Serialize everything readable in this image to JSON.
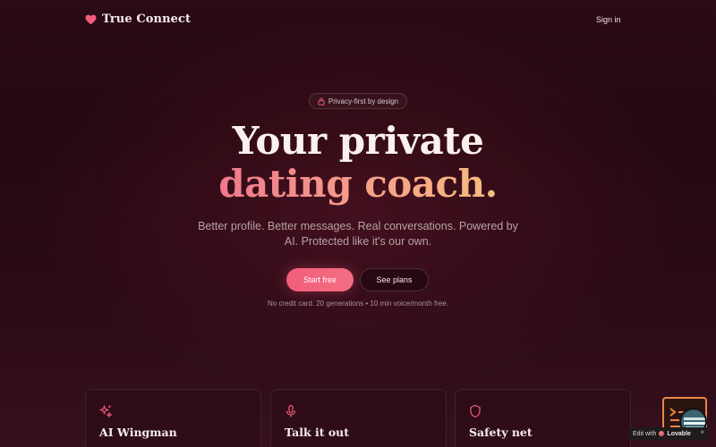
{
  "header": {
    "brand_name": "True Connect",
    "sign_in_label": "Sign in"
  },
  "hero": {
    "badge_label": "Privacy-first by design",
    "title_line1": "Your private",
    "title_line2": "dating coach.",
    "subtitle": "Better profile. Better messages. Real conversations. Powered by AI. Protected like it's our own.",
    "primary_button": "Start free",
    "secondary_button": "See plans",
    "note": "No credit card. 20 generations • 10 min voice/month free."
  },
  "features": [
    {
      "title": "AI Wingman",
      "icon": "sparkles-icon"
    },
    {
      "title": "Talk it out",
      "icon": "microphone-icon"
    },
    {
      "title": "Safety net",
      "icon": "shield-icon"
    }
  ],
  "lovable_badge": {
    "prefix": "Edit with",
    "name": "Lovable",
    "close": "×"
  },
  "colors": {
    "accent": "#f25d7b",
    "gradient_start": "#f0788c",
    "gradient_end": "#f6bd80",
    "background": "#2a0a14"
  }
}
